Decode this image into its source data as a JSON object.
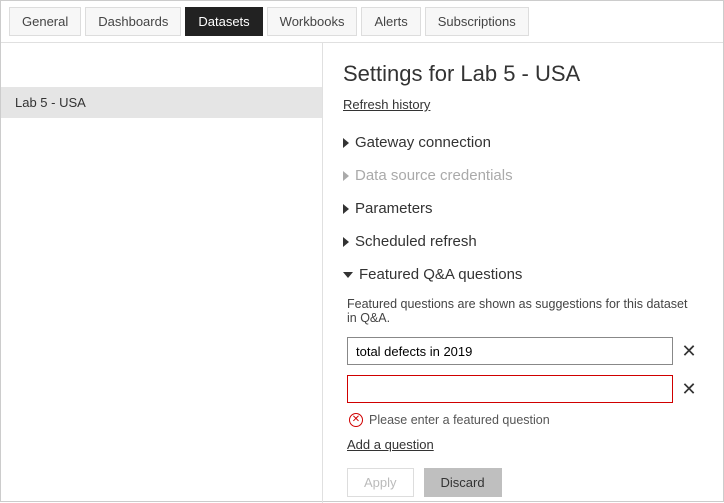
{
  "tabs": {
    "general": "General",
    "dashboards": "Dashboards",
    "datasets": "Datasets",
    "workbooks": "Workbooks",
    "alerts": "Alerts",
    "subscriptions": "Subscriptions"
  },
  "sidebar": {
    "items": [
      {
        "label": "Lab 5 - USA"
      }
    ]
  },
  "page": {
    "title": "Settings for Lab 5 - USA",
    "refresh_link": "Refresh history"
  },
  "sections": {
    "gateway": "Gateway connection",
    "credentials": "Data source credentials",
    "parameters": "Parameters",
    "scheduled": "Scheduled refresh",
    "featured": "Featured Q&A questions"
  },
  "featured": {
    "hint": "Featured questions are shown as suggestions for this dataset in Q&A.",
    "questions": {
      "q1": "total defects in 2019",
      "q2": ""
    },
    "error": "Please enter a featured question",
    "add": "Add a question",
    "apply": "Apply",
    "discard": "Discard"
  }
}
